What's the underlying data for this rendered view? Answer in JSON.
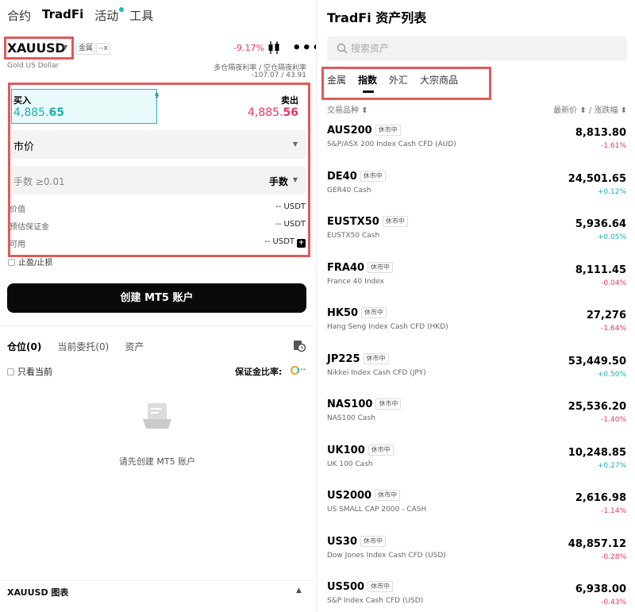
{
  "left": {
    "nav": [
      "合约",
      "TradFi",
      "活动",
      "工具"
    ],
    "symbol": "XAUUSD",
    "tags": [
      "金属",
      "--x"
    ],
    "subname": "Gold US Dollar",
    "change": "-9.17%",
    "rate_label": "多仓隔夜利率 / 空仓隔夜利率",
    "rate_value": "-107.07 / 43.91",
    "buy_label": "买入",
    "buy_price_main": "4,885.",
    "buy_price_tail": "65",
    "spread": "9",
    "sell_label": "卖出",
    "sell_price_main": "4,885.",
    "sell_price_tail": "56",
    "order_type": "市价",
    "qty_placeholder": "手数 ≥0.01",
    "qty_unit": "手数",
    "info": [
      {
        "label": "价值",
        "value": "-- USDT"
      },
      {
        "label": "预估保证金",
        "value": "-- USDT"
      },
      {
        "label": "可用",
        "value": "-- USDT"
      }
    ],
    "tpsl": "止盈/止损",
    "create_button": "创建 MT5 账户",
    "position_tabs": [
      "仓位(0)",
      "当前委托(0)",
      "资产"
    ],
    "only_current": "只看当前",
    "margin_ratio_label": "保证金比率:",
    "margin_ratio_value": "--",
    "empty_text": "请先创建 MT5 账户",
    "chart_title": "XAUUSD 图表"
  },
  "right": {
    "title": "TradFi 资产列表",
    "search_placeholder": "搜索资产",
    "categories": [
      "金属",
      "指数",
      "外汇",
      "大宗商品"
    ],
    "col_left": "交易品种 ⬍",
    "col_right": "最新价 ⬍ / 涨跌幅 ⬍",
    "rows": [
      {
        "symbol": "AUS200",
        "badge": "休市中",
        "desc": "S&P/ASX 200 Index Cash CFD (AUD)",
        "price": "8,813.80",
        "change": "-1.61%",
        "dir": "neg"
      },
      {
        "symbol": "DE40",
        "badge": "休市中",
        "desc": "GER40 Cash",
        "price": "24,501.65",
        "change": "+0.12%",
        "dir": "pos"
      },
      {
        "symbol": "EUSTX50",
        "badge": "休市中",
        "desc": "EUSTX50 Cash",
        "price": "5,936.64",
        "change": "+0.05%",
        "dir": "pos"
      },
      {
        "symbol": "FRA40",
        "badge": "休市中",
        "desc": "France 40 Index",
        "price": "8,111.45",
        "change": "-0.04%",
        "dir": "neg"
      },
      {
        "symbol": "HK50",
        "badge": "休市中",
        "desc": "Hang Seng Index Cash CFD (HKD)",
        "price": "27,276",
        "change": "-1.64%",
        "dir": "neg"
      },
      {
        "symbol": "JP225",
        "badge": "休市中",
        "desc": "Nikkei Index Cash CFD (JPY)",
        "price": "53,449.50",
        "change": "+0.50%",
        "dir": "pos"
      },
      {
        "symbol": "NAS100",
        "badge": "休市中",
        "desc": "NAS100 Cash",
        "price": "25,536.20",
        "change": "-1.40%",
        "dir": "neg"
      },
      {
        "symbol": "UK100",
        "badge": "休市中",
        "desc": "UK 100 Cash",
        "price": "10,248.85",
        "change": "+0.27%",
        "dir": "pos"
      },
      {
        "symbol": "US2000",
        "badge": "休市中",
        "desc": "US SMALL CAP 2000 - CASH",
        "price": "2,616.98",
        "change": "-1.14%",
        "dir": "neg"
      },
      {
        "symbol": "US30",
        "badge": "休市中",
        "desc": "Dow Jones Index Cash CFD (USD)",
        "price": "48,857.12",
        "change": "-0.28%",
        "dir": "neg"
      },
      {
        "symbol": "US500",
        "badge": "休市中",
        "desc": "S&P Index Cash CFD (USD)",
        "price": "6,938.00",
        "change": "-0.43%",
        "dir": "neg"
      }
    ]
  },
  "colors": {
    "accent_teal": "#1ab0ad",
    "negative_red": "#e0386a",
    "highlight_box": "#e05a5a"
  },
  "icons": [
    "candlestick-icon",
    "more-icon",
    "history-icon",
    "search-icon",
    "empty-document-icon"
  ]
}
